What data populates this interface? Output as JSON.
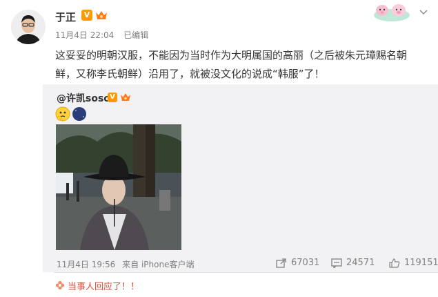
{
  "post": {
    "username": "于正",
    "verified_badge": "V",
    "meta": {
      "date": "11月4日 22:04",
      "edited": "已编辑"
    },
    "text": "这妥妥的明朝汉服，不能因为当时作为大明属国的高丽（之后被朱元璋赐名朝鲜，又称李氏朝鲜）沿用了，就被没文化的说成“韩服”了！",
    "icons": {
      "avatar": "avatar-photo",
      "crown": "crown-icon",
      "sticker": "pig-sticker",
      "more": "chevron-down-icon"
    }
  },
  "repost": {
    "username": "@许凯soso",
    "verified_badge": "V",
    "meta": {
      "date": "11月4日 19:56",
      "source": "来自 iPhone客户端"
    },
    "stats": {
      "reposts": "67031",
      "comments": "24571",
      "likes": "119151"
    },
    "icons": {
      "repost": "share-icon",
      "comment": "comment-icon",
      "like": "thumbs-up-icon"
    }
  },
  "footer": {
    "note": "当事人回应了！！"
  },
  "colors": {
    "accent": "#ff9a00",
    "note_red": "#e5493a",
    "repost_bg": "#f2f2f5",
    "meta_gray": "#808080"
  }
}
